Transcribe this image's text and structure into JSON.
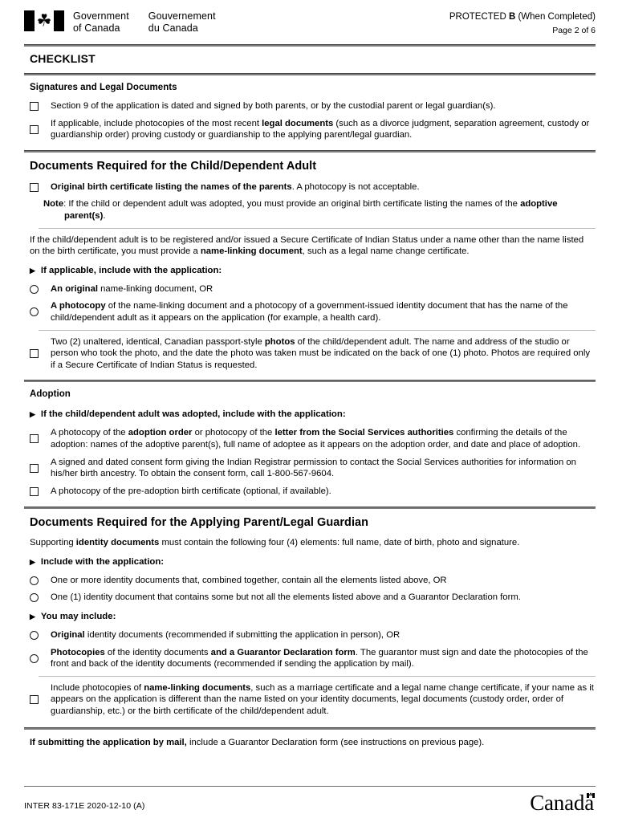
{
  "header": {
    "wordmark_en": "Government\nof Canada",
    "wordmark_en_line1": "Government",
    "wordmark_en_line2": "of Canada",
    "wordmark_fr_line1": "Gouvernement",
    "wordmark_fr_line2": "du Canada",
    "protected_prefix": "PROTECTED ",
    "protected_level": "B",
    "protected_suffix": " (When Completed)",
    "page_number": "Page 2 of 6",
    "flag_leaf": "☘"
  },
  "title": "CHECKLIST",
  "sections": {
    "signatures": {
      "heading": "Signatures and Legal Documents",
      "item1": "Section 9 of the application is dated and signed by both parents, or by the custodial parent or legal guardian(s).",
      "item2_a": "If applicable, include photocopies of the most recent ",
      "item2_b": "legal documents",
      "item2_c": " (such as a divorce judgment, separation agreement, custody or guardianship order) proving custody or guardianship to the applying parent/legal guardian."
    },
    "child": {
      "heading": "Documents Required for the Child/Dependent Adult",
      "birth_cert_bold": "Original birth certificate listing the names of the parents",
      "birth_cert_rest": ". A photocopy is not acceptable.",
      "note_label": "Note",
      "note_a": ": If the child or dependent adult was adopted, you must provide an original birth certificate listing the names of the ",
      "note_b": "adoptive parent(s)",
      "note_c": ".",
      "intro_a": "If the child/dependent adult is to be registered and/or issued a Secure Certificate of Indian Status under a name other than the name listed on the birth certificate, you must provide a ",
      "intro_b": "name-linking document",
      "intro_c": ", such as a legal name change certificate.",
      "arrow1": "If applicable, include with the application:",
      "opt1_b": "An original",
      "opt1_rest": " name-linking document, OR",
      "opt2_b": "A photocopy",
      "opt2_rest": " of the name-linking document and a photocopy of a government-issued identity document that has the name of the child/dependent adult as it appears on the application (for example, a health card).",
      "photos_a": "Two (2) unaltered, identical, Canadian passport-style ",
      "photos_b": "photos",
      "photos_c": " of the child/dependent adult. The name and address of the studio or person who took the photo, and the date the photo was taken must be indicated on the back of one (1) photo. Photos are required only if a Secure Certificate of Indian Status is requested."
    },
    "adoption": {
      "heading": "Adoption",
      "arrow1": "If the child/dependent adult was adopted, include with the application:",
      "item1_a": "A photocopy of the ",
      "item1_b": "adoption order",
      "item1_c": " or photocopy of the ",
      "item1_d": "letter from the Social Services authorities",
      "item1_e": " confirming the details of the adoption: names of the adoptive parent(s), full name of adoptee as it appears on the adoption order, and date and place of adoption.",
      "item2": "A signed and dated consent form giving the Indian Registrar permission to contact the Social Services authorities for information on his/her birth ancestry. To obtain the consent form, call 1-800-567-9604.",
      "item3": "A photocopy of the pre-adoption birth certificate (optional, if available)."
    },
    "guardian": {
      "heading": "Documents Required for the Applying Parent/Legal Guardian",
      "intro_a": "Supporting ",
      "intro_b": "identity documents",
      "intro_c": " must contain the following four (4) elements: full name, date of birth, photo and signature.",
      "arrow1": "Include with the application:",
      "opt1": "One or more identity documents that, combined together, contain all the elements listed above, OR",
      "opt2": "One (1) identity document that contains some but not all the elements listed above and a Guarantor Declaration form.",
      "arrow2": "You may include:",
      "opt3_b": "Original",
      "opt3_rest": " identity documents (recommended if submitting the application in person), OR",
      "opt4_b": "Photocopies",
      "opt4_mid": " of the identity documents ",
      "opt4_b2": "and a Guarantor Declaration form",
      "opt4_rest": ". The guarantor must sign and date the photocopies of the front and back of the identity documents (recommended if sending the application by mail).",
      "namelink_a": "Include photocopies of ",
      "namelink_b": "name-linking documents",
      "namelink_c": ", such as a marriage certificate and a legal name change certificate, if your name as it appears on the application is different than the name listed on your identity documents, legal documents (custody order, order of guardianship, etc.) or the birth certificate of the child/dependent adult."
    },
    "mail_note_b": "If submitting the application by mail,",
    "mail_note_rest": " include a Guarantor Declaration form (see instructions on previous page)."
  },
  "footer": {
    "form_id": "INTER 83-171E 2020-12-10 (A)",
    "canada_wordmark": "Canad",
    "canada_wordmark_tail": "a",
    "flag_leaf": "☘"
  }
}
